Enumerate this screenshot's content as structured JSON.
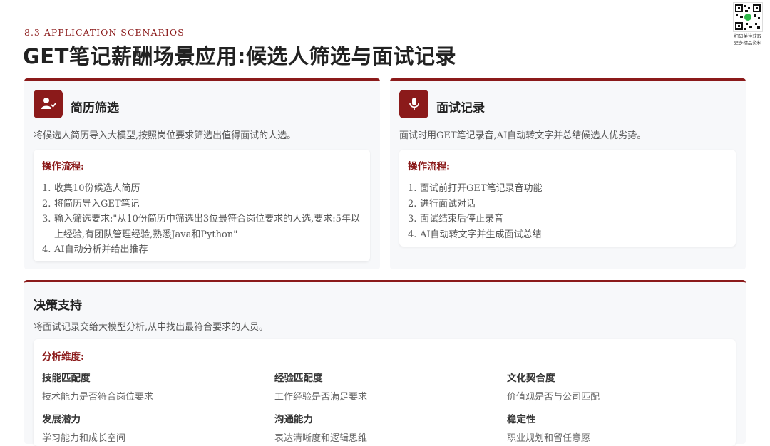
{
  "header": {
    "eyebrow": "8.3 APPLICATION SCENARIOS",
    "title": "GET笔记薪酬场景应用:候选人筛选与面试记录",
    "qr_caption_line1": "扫码关注获取",
    "qr_caption_line2": "更多精品资料"
  },
  "cards": [
    {
      "icon": "user-check-icon",
      "title": "简历筛选",
      "description": "将候选人简历导入大模型,按照岗位要求筛选出值得面试的人选。",
      "process_label": "操作流程:",
      "steps": [
        {
          "num": "1.",
          "text": "收集10份候选人简历"
        },
        {
          "num": "2.",
          "text": "将简历导入GET笔记"
        },
        {
          "num": "3.",
          "text": "输入筛选要求:\"从10份简历中筛选出3位最符合岗位要求的人选,要求:5年以上经验,有团队管理经验,熟悉Java和Python\""
        },
        {
          "num": "4.",
          "text": "AI自动分析并给出推荐"
        }
      ]
    },
    {
      "icon": "microphone-icon",
      "title": "面试记录",
      "description": "面试时用GET笔记录音,AI自动转文字并总结候选人优劣势。",
      "process_label": "操作流程:",
      "steps": [
        {
          "num": "1.",
          "text": "面试前打开GET笔记录音功能"
        },
        {
          "num": "2.",
          "text": "进行面试对话"
        },
        {
          "num": "3.",
          "text": "面试结束后停止录音"
        },
        {
          "num": "4.",
          "text": "AI自动转文字并生成面试总结"
        }
      ]
    }
  ],
  "decision": {
    "title": "决策支持",
    "description": "将面试记录交给大模型分析,从中找出最符合要求的人员。",
    "analysis_label": "分析维度:",
    "dimensions": [
      {
        "name": "技能匹配度",
        "desc": "技术能力是否符合岗位要求"
      },
      {
        "name": "经验匹配度",
        "desc": "工作经验是否满足要求"
      },
      {
        "name": "文化契合度",
        "desc": "价值观是否与公司匹配"
      },
      {
        "name": "发展潜力",
        "desc": "学习能力和成长空间"
      },
      {
        "name": "沟通能力",
        "desc": "表达清晰度和逻辑思维"
      },
      {
        "name": "稳定性",
        "desc": "职业规划和留任意愿"
      }
    ]
  },
  "colors": {
    "accent": "#8b1a1a",
    "card_bg": "#f7f8fa"
  }
}
